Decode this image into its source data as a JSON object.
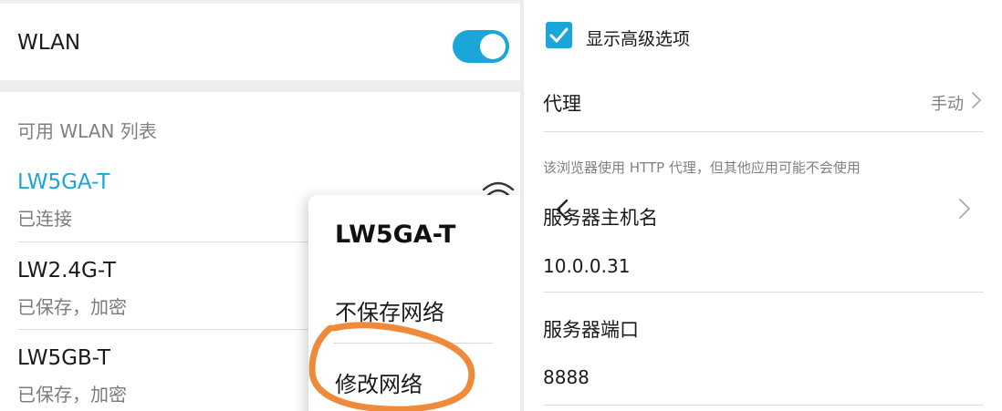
{
  "wlan": {
    "title": "WLAN",
    "enabled": true,
    "list_header": "可用 WLAN 列表",
    "networks": [
      {
        "name": "LW5GA-T",
        "status": "已连接"
      },
      {
        "name": "LW2.4G-T",
        "status": "已保存，加密"
      },
      {
        "name": "LW5GB-T",
        "status": "已保存，加密"
      }
    ]
  },
  "popup": {
    "title": "LW5GA-T",
    "items": [
      "不保存网络",
      "修改网络"
    ]
  },
  "advanced": {
    "show_advanced_label": "显示高级选项",
    "show_advanced_checked": true,
    "proxy_label": "代理",
    "proxy_value": "手动",
    "proxy_hint": "该浏览器使用 HTTP 代理，但其他应用可能不会使用",
    "host_label": "服务器主机名",
    "host_value": "10.0.0.31",
    "port_label": "服务器端口",
    "port_value": "8888"
  },
  "colors": {
    "accent": "#1aa6d9",
    "annotation": "#ef8a3b"
  },
  "icons": [
    "wifi-icon",
    "check-icon",
    "chevron-right-icon",
    "chevron-left-icon"
  ]
}
